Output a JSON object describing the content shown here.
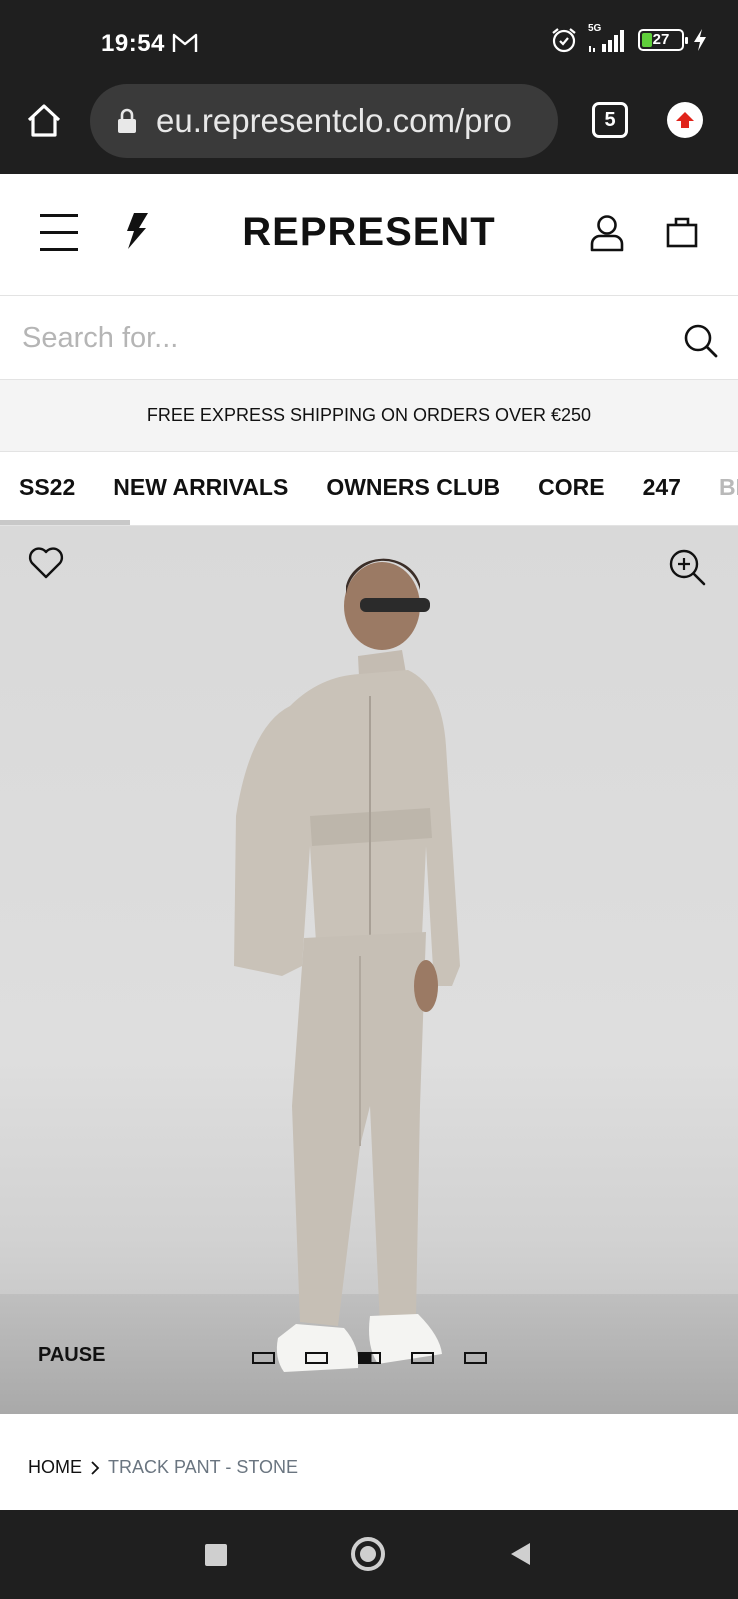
{
  "status_bar": {
    "time": "19:54",
    "network": "5G",
    "battery": "27",
    "battery_level": 0.27
  },
  "browser": {
    "url": "eu.representclo.com/pro",
    "tab_count": "5"
  },
  "header": {
    "brand": "REPRESENT"
  },
  "search": {
    "placeholder": "Search for..."
  },
  "banner": {
    "text": "FREE EXPRESS SHIPPING ON ORDERS OVER €250"
  },
  "categories": [
    "SS22",
    "NEW ARRIVALS",
    "OWNERS CLUB",
    "CORE",
    "247",
    "BL"
  ],
  "hero": {
    "pause_label": "PAUSE",
    "slide_count": 5,
    "active_slide": 3
  },
  "breadcrumb": {
    "home": "HOME",
    "current": "TRACK PANT - STONE"
  },
  "colors": {
    "system_bar": "#1f1f1f",
    "url_box": "#3a3a3a",
    "banner_bg": "#f4f4f4",
    "battery_green": "#5fcf3a",
    "breadcrumb_current": "#6a7580"
  }
}
